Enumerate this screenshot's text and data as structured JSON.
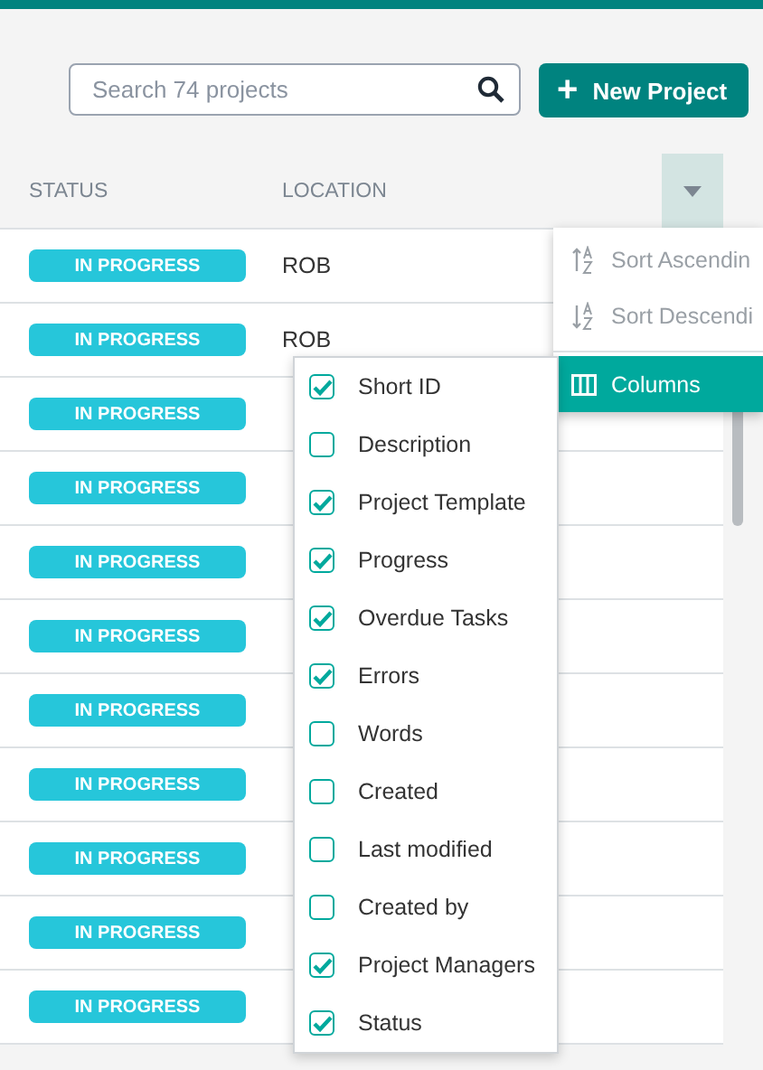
{
  "search": {
    "placeholder": "Search 74 projects"
  },
  "new_project_button": {
    "icon": "+",
    "label": "New Project"
  },
  "table": {
    "columns": [
      "STATUS",
      "LOCATION"
    ],
    "rows": [
      {
        "status": "IN PROGRESS",
        "location": "ROB"
      },
      {
        "status": "IN PROGRESS",
        "location": "ROB"
      },
      {
        "status": "IN PROGRESS"
      },
      {
        "status": "IN PROGRESS"
      },
      {
        "status": "IN PROGRESS"
      },
      {
        "status": "IN PROGRESS"
      },
      {
        "status": "IN PROGRESS"
      },
      {
        "status": "IN PROGRESS"
      },
      {
        "status": "IN PROGRESS"
      },
      {
        "status": "IN PROGRESS"
      },
      {
        "status": "IN PROGRESS"
      }
    ]
  },
  "column_menu": {
    "items": [
      {
        "kind": "sort-asc",
        "label": "Sort Ascendin",
        "disabled": true,
        "selected": false
      },
      {
        "kind": "sort-desc",
        "label": "Sort Descendi",
        "disabled": true,
        "selected": false
      },
      {
        "kind": "columns",
        "label": "Columns",
        "disabled": false,
        "selected": true
      }
    ]
  },
  "columns_submenu": {
    "items": [
      {
        "label": "Short ID",
        "checked": true
      },
      {
        "label": "Description",
        "checked": false
      },
      {
        "label": "Project Template",
        "checked": true
      },
      {
        "label": "Progress",
        "checked": true
      },
      {
        "label": "Overdue Tasks",
        "checked": true
      },
      {
        "label": "Errors",
        "checked": true
      },
      {
        "label": "Words",
        "checked": false
      },
      {
        "label": "Created",
        "checked": false
      },
      {
        "label": "Last modified",
        "checked": false
      },
      {
        "label": "Created by",
        "checked": false
      },
      {
        "label": "Project Managers",
        "checked": true
      },
      {
        "label": "Status",
        "checked": true
      }
    ]
  }
}
